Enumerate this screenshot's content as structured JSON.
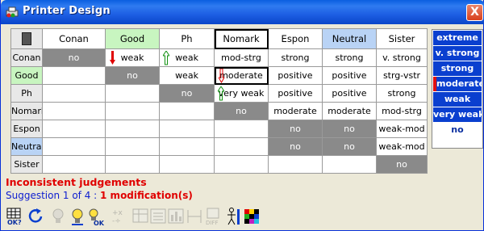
{
  "window": {
    "title": "Printer Design",
    "close_label": "X"
  },
  "grid": {
    "columns": [
      "Conan",
      "Good",
      "Ph",
      "Nomark",
      "Espon",
      "Neutral",
      "Sister"
    ],
    "rows": [
      {
        "label": "Conan",
        "cells": [
          "no",
          "weak",
          "weak",
          "mod-strg",
          "strong",
          "strong",
          "v. strong"
        ]
      },
      {
        "label": "Good",
        "cells": [
          "",
          "no",
          "weak",
          "moderate",
          "positive",
          "positive",
          "strg-vstr"
        ]
      },
      {
        "label": "Ph",
        "cells": [
          "",
          "",
          "no",
          "very weak",
          "positive",
          "positive",
          "strong"
        ]
      },
      {
        "label": "Nomark",
        "cells": [
          "",
          "",
          "",
          "no",
          "moderate",
          "moderate",
          "mod-strg"
        ]
      },
      {
        "label": "Espon",
        "cells": [
          "",
          "",
          "",
          "",
          "no",
          "no",
          "weak-mod"
        ]
      },
      {
        "label": "Neutral",
        "cells": [
          "",
          "",
          "",
          "",
          "no",
          "no",
          "weak-mod"
        ]
      },
      {
        "label": "Sister",
        "cells": [
          "",
          "",
          "",
          "",
          "",
          "",
          "no"
        ]
      }
    ]
  },
  "scale": {
    "items": [
      "extreme",
      "v. strong",
      "strong",
      "moderate",
      "weak",
      "very weak",
      "no"
    ],
    "selected": "moderate"
  },
  "messages": {
    "title": "Inconsistent judgements",
    "suggestion_prefix": "Suggestion 1 of 4 : ",
    "suggestion_count": "1 modification(s)"
  },
  "toolbar": {
    "buttons": [
      "ok-grid-icon",
      "refresh-icon",
      "bulb-disabled-icon",
      "bulb-icon",
      "bulb-ok-icon",
      "calc-disabled-icon",
      "table-disabled-icon",
      "list-disabled-icon",
      "chart-disabled-icon",
      "split-disabled-icon",
      "diff-disabled-icon",
      "person-icon",
      "color-grid-icon"
    ]
  },
  "colors": {
    "title_bar": "#0a5fe0",
    "scale_blue": "#0a3fcf",
    "error_red": "#e00000",
    "info_blue": "#1020d0"
  }
}
